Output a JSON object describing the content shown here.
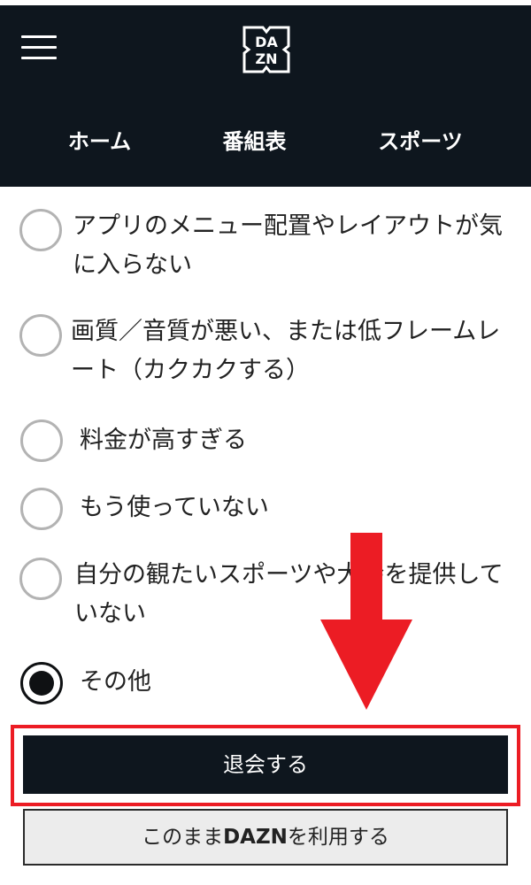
{
  "header": {
    "logo_top": "DA",
    "logo_bottom": "ZN",
    "nav": [
      {
        "label": "ホーム"
      },
      {
        "label": "番組表"
      },
      {
        "label": "スポーツ"
      }
    ]
  },
  "options": [
    {
      "label": "アプリのメニュー配置やレイアウトが気に入らない",
      "selected": false
    },
    {
      "label": "画質／音質が悪い、または低フレームレート（カクカクする）",
      "selected": false
    },
    {
      "label": "料金が高すぎる",
      "selected": false
    },
    {
      "label": "もう使っていない",
      "selected": false
    },
    {
      "label": "自分の観たいスポーツや大会を提供していない",
      "selected": false
    },
    {
      "label": "その他",
      "selected": true
    }
  ],
  "actions": {
    "cancel_label": "退会する",
    "continue_prefix": "このまま",
    "continue_brand": "DAZN",
    "continue_suffix": "を利用する"
  },
  "colors": {
    "header_bg": "#0e161e",
    "annotation_red": "#ec1c24"
  }
}
